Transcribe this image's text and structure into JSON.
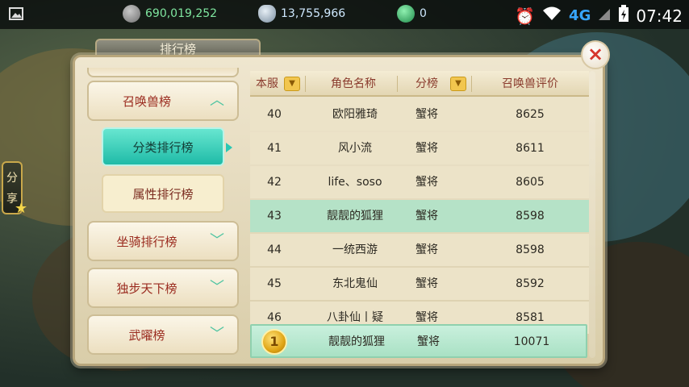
{
  "status_bar": {
    "currencies": [
      {
        "icon": "coin-icon",
        "value": "690,019,252",
        "color": "#7fe6a0"
      },
      {
        "icon": "silver-ingot-icon",
        "value": "13,755,966",
        "color": "#cfe9ff"
      },
      {
        "icon": "jade-icon",
        "value": "0",
        "color": "#cfe9ff"
      }
    ],
    "network": "4G",
    "time": "07:42"
  },
  "panel": {
    "title": "排行榜"
  },
  "menu": {
    "items": [
      {
        "label": "召唤兽榜",
        "state": "expanded"
      },
      {
        "label": "坐骑排行榜",
        "state": "collapsed"
      },
      {
        "label": "独步天下榜",
        "state": "collapsed"
      },
      {
        "label": "武曜榜",
        "state": "collapsed"
      }
    ],
    "sub_items": [
      {
        "label": "分类排行榜",
        "active": true
      },
      {
        "label": "属性排行榜",
        "active": false
      }
    ]
  },
  "table": {
    "headers": [
      "本服",
      "角色名称",
      "分榜",
      "召唤兽评价"
    ],
    "rows": [
      {
        "rank": "40",
        "name": "欧阳雅琦",
        "category": "蟹将",
        "score": "8625",
        "highlight": false
      },
      {
        "rank": "41",
        "name": "风小流",
        "category": "蟹将",
        "score": "8611",
        "highlight": false
      },
      {
        "rank": "42",
        "name": "life、soso",
        "category": "蟹将",
        "score": "8605",
        "highlight": false
      },
      {
        "rank": "43",
        "name": "靓靓的狐狸",
        "category": "蟹将",
        "score": "8598",
        "highlight": true
      },
      {
        "rank": "44",
        "name": "一统西游",
        "category": "蟹将",
        "score": "8598",
        "highlight": false
      },
      {
        "rank": "45",
        "name": "东北鬼仙",
        "category": "蟹将",
        "score": "8592",
        "highlight": false
      },
      {
        "rank": "46",
        "name": "八卦仙丨疑",
        "category": "蟹将",
        "score": "8581",
        "highlight": false
      }
    ],
    "my_row": {
      "rank": "1",
      "name": "靓靓的狐狸",
      "category": "蟹将",
      "score": "10071"
    }
  },
  "share": {
    "label": "分享"
  },
  "colors": {
    "accent": "#1fbba7",
    "highlight_row": "#b5e2c7",
    "title_text": "#9a2a1e"
  }
}
